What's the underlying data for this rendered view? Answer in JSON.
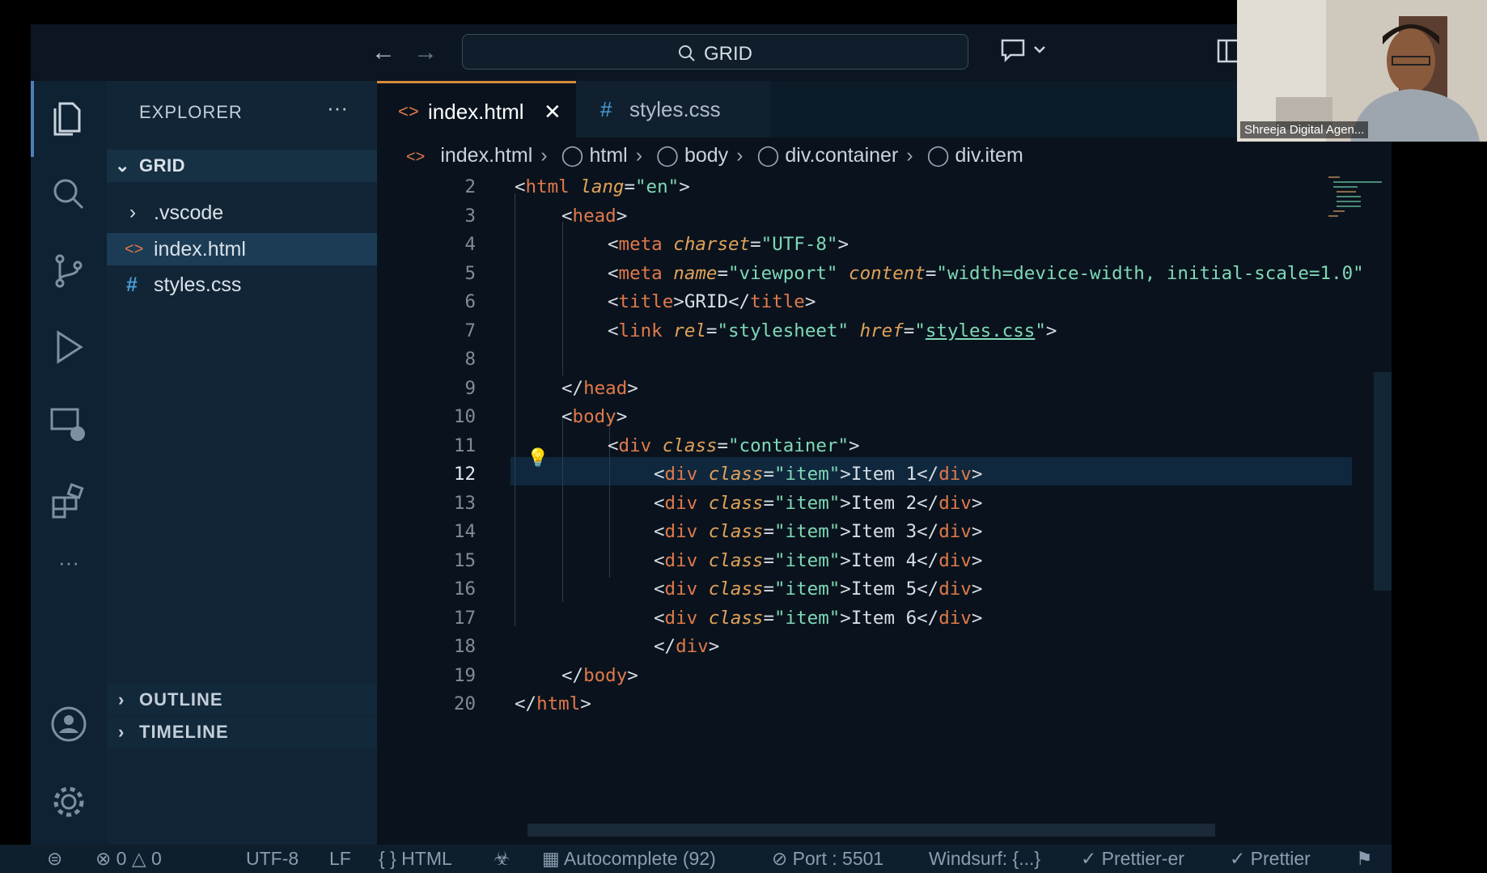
{
  "titlebar": {
    "search_text": "GRID",
    "back_icon": "arrow-left-icon",
    "forward_icon": "arrow-right-icon"
  },
  "activity_icons": [
    "files-icon",
    "search-icon",
    "source-control-icon",
    "run-debug-icon",
    "remote-explorer-icon",
    "extensions-icon",
    "more-icon",
    "account-icon",
    "settings-gear-icon"
  ],
  "sidebar": {
    "title": "EXPLORER",
    "more": "···",
    "folder": "GRID",
    "items": [
      {
        "label": ".vscode",
        "type": "folder"
      },
      {
        "label": "index.html",
        "type": "html"
      },
      {
        "label": "styles.css",
        "type": "css"
      }
    ],
    "outline": "OUTLINE",
    "timeline": "TIMELINE"
  },
  "tabs": [
    {
      "label": "index.html",
      "icon": "<>"
    },
    {
      "label": "styles.css",
      "icon": "#"
    }
  ],
  "breadcrumb": [
    "index.html",
    "html",
    "body",
    "div.container",
    "div.item"
  ],
  "code_lines": [
    "2",
    "3",
    "4",
    "5",
    "6",
    "7",
    "8",
    "9",
    "10",
    "11",
    "12",
    "13",
    "14",
    "15",
    "16",
    "17",
    "18",
    "19",
    "20"
  ],
  "status": {
    "errors": "0",
    "warnings": "0",
    "encoding": "UTF-8",
    "eol": "LF",
    "language": "HTML",
    "autocomplete": "Autocomplete (92)",
    "port": "Port : 5501",
    "windsurf": "Windsurf: {...}",
    "prettier_er": "Prettier-er",
    "prettier": "Prettier"
  },
  "webcam": {
    "name": "Shreeja Digital Agen..."
  },
  "colors": {
    "tag": "#e0794a",
    "attribute": "#e0a25a",
    "string": "#7fd9b6",
    "active_tab_border": "#d88a3a"
  }
}
